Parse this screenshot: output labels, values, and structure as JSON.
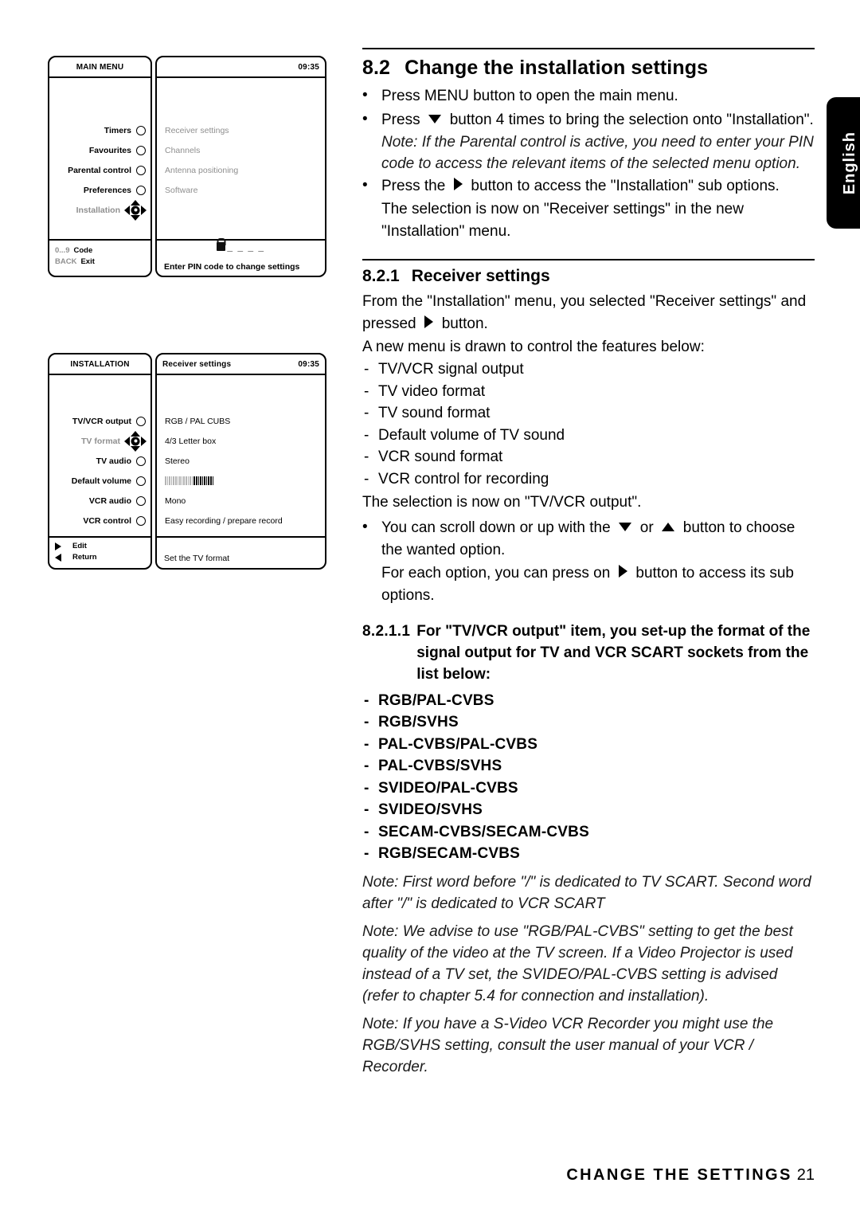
{
  "document": {
    "footer_title": "CHANGE THE SETTINGS",
    "page_number": "21",
    "language_tab": "English"
  },
  "figures": {
    "main_menu": {
      "left_pane": {
        "title": "MAIN MENU",
        "items": [
          {
            "label": "Timers",
            "control": "radio",
            "selected": false
          },
          {
            "label": "Favourites",
            "control": "radio",
            "selected": false
          },
          {
            "label": "Parental control",
            "control": "radio",
            "selected": false
          },
          {
            "label": "Preferences",
            "control": "radio",
            "selected": false
          },
          {
            "label": "Installation",
            "control": "dpad",
            "selected": true
          }
        ],
        "hints": [
          {
            "key": "0...9",
            "value": "Code"
          },
          {
            "key": "BACK",
            "value": "Exit"
          }
        ]
      },
      "right_pane": {
        "clock": "09:35",
        "items": [
          {
            "label": "Receiver settings"
          },
          {
            "label": "Channels"
          },
          {
            "label": "Antenna positioning"
          },
          {
            "label": "Software"
          }
        ],
        "pin_dashes": "_ _ _ _",
        "footer_message": "Enter PIN code to change settings"
      }
    },
    "installation": {
      "left_pane": {
        "title": "INSTALLATION",
        "items": [
          {
            "label": "TV/VCR output",
            "control": "radio",
            "selected": false
          },
          {
            "label": "TV format",
            "control": "dpad",
            "selected": true
          },
          {
            "label": "TV audio",
            "control": "radio",
            "selected": false
          },
          {
            "label": "Default volume",
            "control": "radio",
            "selected": false
          },
          {
            "label": "VCR audio",
            "control": "radio",
            "selected": false
          },
          {
            "label": "VCR control",
            "control": "radio",
            "selected": false
          }
        ],
        "hints": [
          {
            "icon": "play-right-triangle",
            "value": "Edit"
          },
          {
            "icon": "play-left-triangle",
            "value": "Return"
          }
        ]
      },
      "right_pane": {
        "title": "Receiver settings",
        "clock": "09:35",
        "values": [
          {
            "label": "RGB / PAL CUBS",
            "type": "text"
          },
          {
            "label": "4/3 Letter box",
            "type": "text"
          },
          {
            "label": "Stereo",
            "type": "text"
          },
          {
            "label": "",
            "type": "volume",
            "level": 60
          },
          {
            "label": "Mono",
            "type": "text"
          },
          {
            "label": "Easy recording / prepare record",
            "type": "text"
          }
        ],
        "footer_message": "Set the TV format"
      }
    }
  },
  "content": {
    "section": {
      "number": "8.2",
      "title": "Change the installation settings"
    },
    "bullet_1": "Press MENU button to open the main menu.",
    "bullet_2_pre": "Press",
    "bullet_2_post": "button 4 times to bring the selection onto \"Installation\".",
    "note_1": "Note: If the Parental control is active, you need to enter your PIN code to access the relevant items of the selected menu option.",
    "bullet_3_pre": "Press the",
    "bullet_3_post": "button to access the \"Installation\" sub options.",
    "bullet_3_line2": "The selection is now on \"Receiver settings\" in the new \"Installation\" menu.",
    "subsection": {
      "number": "8.2.1",
      "title": "Receiver settings"
    },
    "para_1_pre": "From the \"Installation\" menu, you selected \"Receiver settings\" and pressed",
    "para_1_post": "button.",
    "para_2": "A new menu is drawn to control the features below:",
    "feature_list": [
      "TV/VCR signal output",
      "TV video format",
      "TV sound format",
      "Default volume of TV sound",
      "VCR sound format",
      "VCR control for recording"
    ],
    "para_3": "The selection is now on \"TV/VCR output\".",
    "bullet_4_pre": "You can scroll down or up with the",
    "bullet_4_mid": "or",
    "bullet_4_post": "button to choose the wanted option.",
    "bullet_4_line2_pre": "For each option, you can press on",
    "bullet_4_line2_post": "button to access its sub options.",
    "subsubsection": {
      "number": "8.2.1.1",
      "title": "For \"TV/VCR output\" item, you set-up the format of the signal output for TV and VCR SCART sockets from the list below:"
    },
    "format_list": [
      "RGB/PAL-CVBS",
      "RGB/SVHS",
      "PAL-CVBS/PAL-CVBS",
      "PAL-CVBS/SVHS",
      "SVIDEO/PAL-CVBS",
      "SVIDEO/SVHS",
      "SECAM-CVBS/SECAM-CVBS",
      "RGB/SECAM-CVBS"
    ],
    "note_2": "Note: First word before \"/\" is dedicated to TV SCART. Second word after \"/\" is dedicated to VCR SCART",
    "note_3": "Note: We advise to use \"RGB/PAL-CVBS\" setting to get the best quality of the video at the TV screen. If a Video Projector is used instead of a TV set, the SVIDEO/PAL-CVBS setting is advised (refer to chapter 5.4 for connection and installation).",
    "note_4": "Note: If you have a S-Video VCR  Recorder you might use the RGB/SVHS setting, consult the user manual of your VCR / Recorder."
  }
}
